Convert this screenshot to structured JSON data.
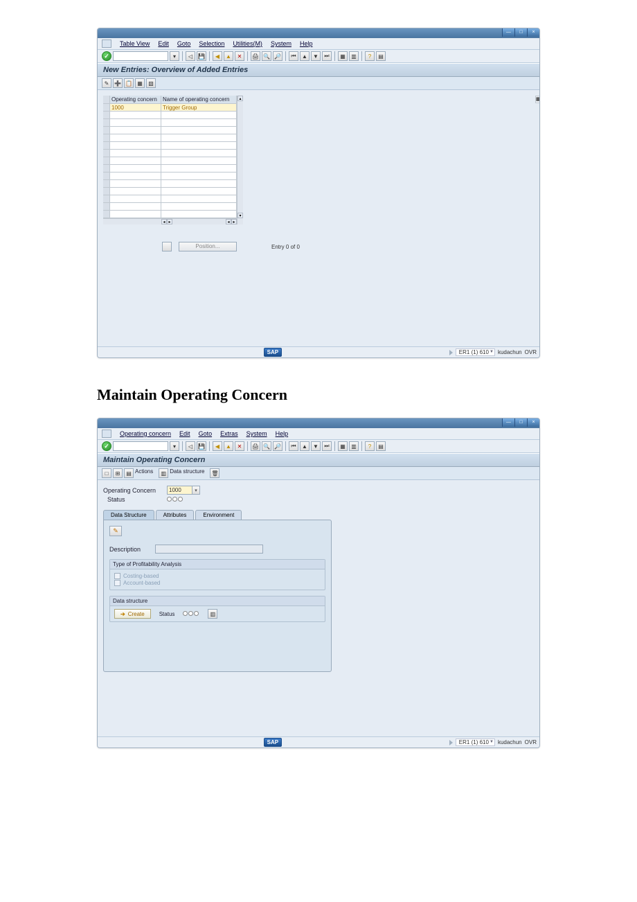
{
  "screen1": {
    "window_buttons": {
      "min": "—",
      "max": "□",
      "close": "×"
    },
    "menu": [
      "Table View",
      "Edit",
      "Goto",
      "Selection",
      "Utilities(M)",
      "System",
      "Help"
    ],
    "title": "New Entries: Overview of Added Entries",
    "table": {
      "columns": [
        "Operating concern",
        "Name of operating concern"
      ],
      "rows": [
        {
          "c1": "1000",
          "c2": "Trigger Group"
        }
      ]
    },
    "position_btn": "Position...",
    "entry_text": "Entry 0 of 0",
    "status": {
      "system": "ER1 (1) 610",
      "host": "kudachun",
      "mode": "OVR"
    }
  },
  "heading": "Maintain Operating Concern",
  "screen2": {
    "window_buttons": {
      "min": "—",
      "max": "□",
      "close": "×"
    },
    "menu": [
      "Operating concern",
      "Edit",
      "Goto",
      "Extras",
      "System",
      "Help"
    ],
    "title": "Maintain Operating Concern",
    "apptoolbar": {
      "actions": "Actions",
      "ds": "Data structure"
    },
    "fields": {
      "operating_concern_label": "Operating Concern",
      "operating_concern_value": "1000",
      "status_label": "Status",
      "status_value": "○○○"
    },
    "tabs": [
      "Data Structure",
      "Attributes",
      "Environment"
    ],
    "desc_label": "Description",
    "group_profit": {
      "title": "Type of Profitability Analysis",
      "opt1": "Costing-based",
      "opt2": "Account-based"
    },
    "group_ds": {
      "title": "Data structure",
      "create": "Create",
      "status_lbl": "Status",
      "status_val": "○○○"
    },
    "status": {
      "system": "ER1 (1) 610",
      "host": "kudachun",
      "mode": "OVR"
    }
  }
}
